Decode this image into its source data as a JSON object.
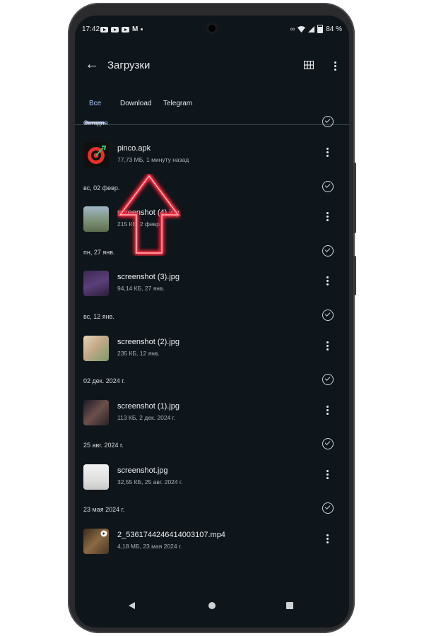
{
  "status_bar": {
    "time": "17:42",
    "battery": "84 %"
  },
  "app_bar": {
    "title": "Загрузки"
  },
  "tabs": [
    {
      "label": "Все",
      "active": true
    },
    {
      "label": "Download",
      "active": false
    },
    {
      "label": "Telegram",
      "active": false
    }
  ],
  "sections": [
    {
      "label": "Сегодня"
    },
    {
      "label": "вс, 02 февр."
    },
    {
      "label": "пн, 27 янв."
    },
    {
      "label": "вс, 12 янв."
    },
    {
      "label": "02 дек. 2024 г."
    },
    {
      "label": "25 авг. 2024 г."
    },
    {
      "label": "23 мая 2024 г."
    }
  ],
  "files": [
    {
      "name": "pinco.apk",
      "meta": "77,73 МБ, 1 минуту назад",
      "thumb": "app-icon"
    },
    {
      "name": "screenshot (4).jpg",
      "meta": "215 КБ, 2 февр.",
      "thumb": "image-thumbnail"
    },
    {
      "name": "screenshot (3).jpg",
      "meta": "94,14 КБ, 27 янв.",
      "thumb": "image-thumbnail"
    },
    {
      "name": "screenshot (2).jpg",
      "meta": "235 КБ, 12 янв.",
      "thumb": "image-thumbnail"
    },
    {
      "name": "screenshot (1).jpg",
      "meta": "113 КБ, 2 дек. 2024 г.",
      "thumb": "image-thumbnail"
    },
    {
      "name": "screenshot.jpg",
      "meta": "32,55 КБ, 25 авг. 2024 г.",
      "thumb": "image-thumbnail"
    },
    {
      "name": "2_5361744246414003107.mp4",
      "meta": "4,18 МБ, 23 мая 2024 г.",
      "thumb": "video-thumbnail"
    }
  ],
  "colors": {
    "background": "#0f161b",
    "accent": "#a8c8ff",
    "arrow": "#ff2a3d"
  }
}
